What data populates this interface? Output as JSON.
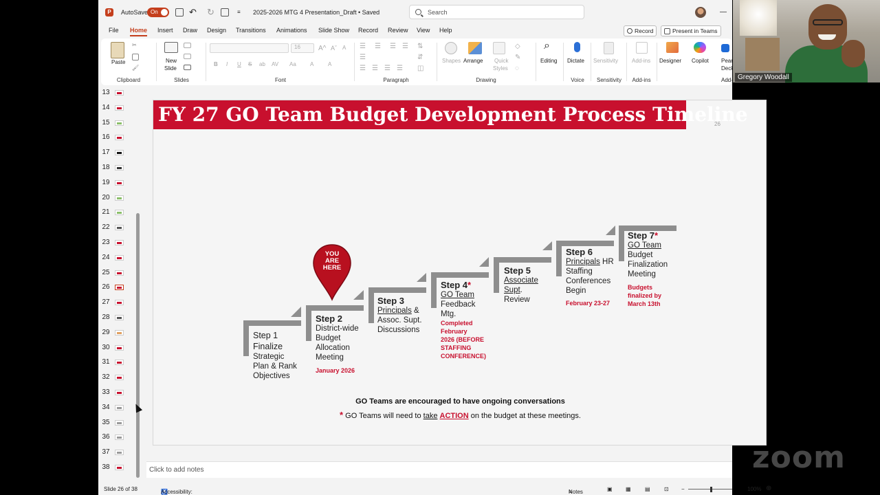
{
  "titlebar": {
    "autosave_label": "AutoSave",
    "autosave_state": "On",
    "file_name": "2025-2026 MTG 4 Presentation_Draft",
    "save_state": "• Saved",
    "search_placeholder": "Search",
    "minimize_glyph": "—"
  },
  "tabs": [
    "File",
    "Home",
    "Insert",
    "Draw",
    "Design",
    "Transitions",
    "Animations",
    "Slide Show",
    "Record",
    "Review",
    "View",
    "Help"
  ],
  "active_tab": "Home",
  "tab_buttons": {
    "record": "Record",
    "present_in_teams": "Present in Teams"
  },
  "ribbon": {
    "clipboard": {
      "paste": "Paste",
      "label": "Clipboard"
    },
    "slides": {
      "new_slide": "New",
      "new_slide2": "Slide",
      "label": "Slides"
    },
    "font": {
      "size": "16",
      "bold": "B",
      "italic": "I",
      "underline": "U",
      "strike": "S",
      "shadow": "ab",
      "spacing": "AV",
      "case": "Aa",
      "highlight": "A",
      "color": "A",
      "label": "Font"
    },
    "paragraph": {
      "label": "Paragraph"
    },
    "drawing": {
      "shapes": "Shapes",
      "arrange": "Arrange",
      "quick_styles": "Quick",
      "quick_styles2": "Styles",
      "label": "Drawing"
    },
    "editing": {
      "editing": "Editing"
    },
    "voice": {
      "dictate": "Dictate",
      "label": "Voice"
    },
    "sensitivity": {
      "sensitivity": "Sensitivity",
      "label": "Sensitivity"
    },
    "addins": {
      "addins": "Add-ins",
      "label": "Add-ins"
    },
    "designer": "Designer",
    "copilot": "Copilot",
    "pear": "Pear",
    "deck": "Deck",
    "addin_label": "Add-i"
  },
  "thumbnails": [
    {
      "n": "13",
      "accent": "#c8102e"
    },
    {
      "n": "14",
      "accent": "#c8102e"
    },
    {
      "n": "15",
      "accent": "#8bbf6a"
    },
    {
      "n": "16",
      "accent": "#c8102e"
    },
    {
      "n": "17",
      "accent": "#111111"
    },
    {
      "n": "18",
      "accent": "#333333"
    },
    {
      "n": "19",
      "accent": "#c8102e"
    },
    {
      "n": "20",
      "accent": "#8bbf6a"
    },
    {
      "n": "21",
      "accent": "#8bbf6a"
    },
    {
      "n": "22",
      "accent": "#555555"
    },
    {
      "n": "23",
      "accent": "#c8102e"
    },
    {
      "n": "24",
      "accent": "#c8102e"
    },
    {
      "n": "25",
      "accent": "#c8102e"
    },
    {
      "n": "26",
      "accent": "#c8102e"
    },
    {
      "n": "27",
      "accent": "#c8102e"
    },
    {
      "n": "28",
      "accent": "#555555"
    },
    {
      "n": "29",
      "accent": "#e0a060"
    },
    {
      "n": "30",
      "accent": "#c8102e"
    },
    {
      "n": "31",
      "accent": "#c8102e"
    },
    {
      "n": "32",
      "accent": "#c8102e"
    },
    {
      "n": "33",
      "accent": "#c8102e"
    },
    {
      "n": "34",
      "accent": "#999999"
    },
    {
      "n": "35",
      "accent": "#999999"
    },
    {
      "n": "36",
      "accent": "#999999"
    },
    {
      "n": "37",
      "accent": "#999999"
    },
    {
      "n": "38",
      "accent": "#c8102e"
    }
  ],
  "slide": {
    "title": "FY 27 GO Team Budget Development Process Timeline",
    "number": "26",
    "pin_text": [
      "YOU",
      "ARE",
      "HERE"
    ],
    "steps": {
      "s1": {
        "l1": "Step 1",
        "l2": "Finalize",
        "l3": "Strategic",
        "l4": "Plan & Rank",
        "l5": "Objectives"
      },
      "s2": {
        "head": "Step 2",
        "l1": "District-wide",
        "l2": "Budget",
        "l3": "Allocation",
        "l4": "Meeting",
        "date": "January 2026"
      },
      "s3": {
        "head": "Step 3",
        "u1": "Principals",
        "l1": " &",
        "l2": "Assoc. Supt.",
        "l3": "Discussions"
      },
      "s4": {
        "head": "Step 4",
        "star": "*",
        "u1": "GO  Team",
        "l1": "Feedback",
        "l2": "Mtg.",
        "r1": "Completed",
        "r2": "February",
        "r3": "2026 (BEFORE",
        "r4": "STAFFING",
        "r5": "CONFERENCE)"
      },
      "s5": {
        "head": "Step 5",
        "u1": "Associate",
        "u2": "Supt",
        "l1": ".",
        "l2": "Review"
      },
      "s6": {
        "head": "Step 6",
        "u1": "Principals",
        "l1": " HR",
        "l2": "Staffing",
        "l3": "Conferences",
        "l4": "Begin",
        "date": "February 23-27"
      },
      "s7": {
        "head": "Step 7",
        "star": "*",
        "u1": "GO Team",
        "l1": "Budget",
        "l2": "Finalization",
        "l3": "Meeting",
        "r1": "Budgets",
        "r2": "finalized by",
        "r3": "March 13th"
      }
    },
    "note1": "GO Teams are encouraged to have ongoing conversations",
    "note2_star": "*",
    "note2_a": " GO Teams will need to ",
    "note2_take": "take",
    "note2_action": "ACTION",
    "note2_b": " on the budget at these meetings."
  },
  "notes_placeholder": "Click to add notes",
  "status": {
    "slide_of": "Slide 26 of 38",
    "accessibility": "Accessibility: Investigate",
    "notes": "Notes",
    "zoom": "100%"
  },
  "video": {
    "participant": "Gregory Woodall"
  },
  "zoom_watermark": "zoom",
  "colors": {
    "accent": "#c43e1c",
    "slide_red": "#c8102e",
    "stair_gray": "#8e8e8e"
  }
}
